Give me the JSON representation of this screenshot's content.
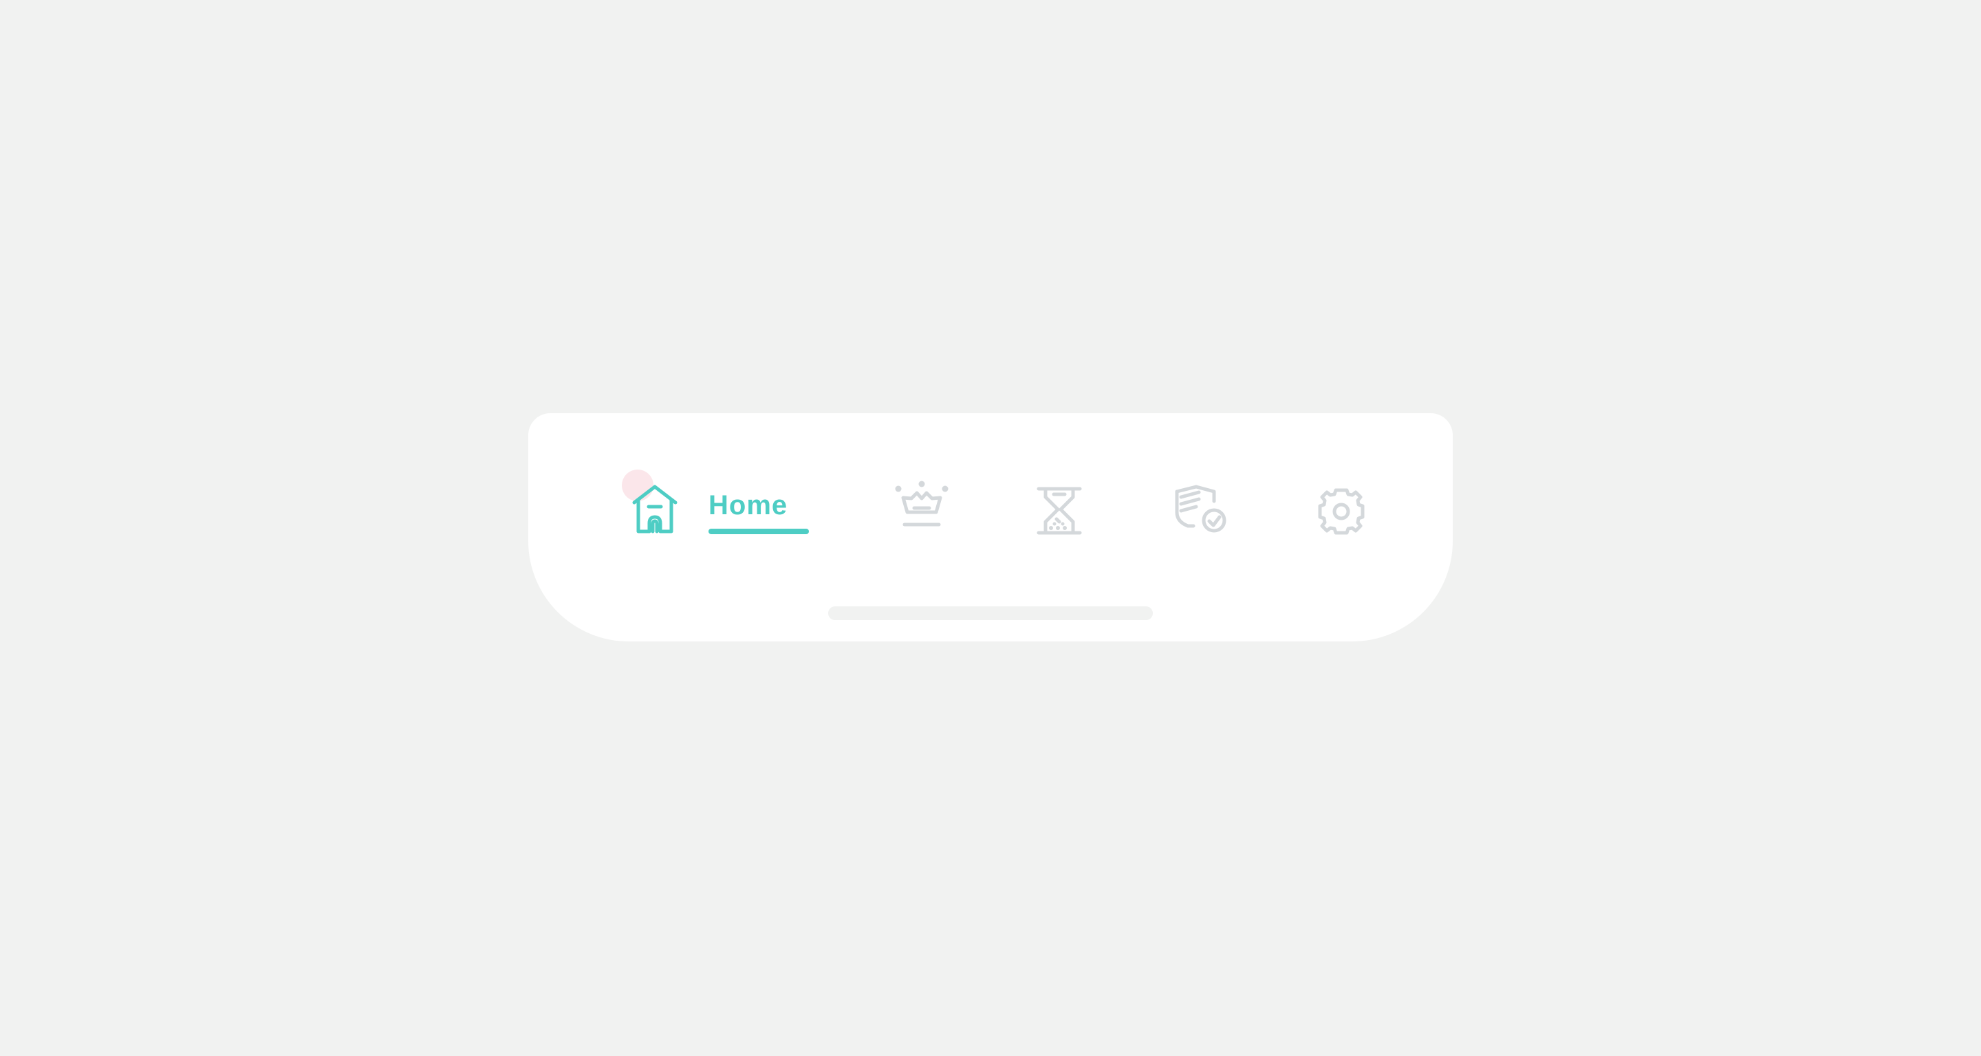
{
  "tabbar": {
    "tabs": [
      {
        "id": "home",
        "label": "Home",
        "icon": "home-icon",
        "active": true
      },
      {
        "id": "premium",
        "label": "",
        "icon": "crown-icon",
        "active": false
      },
      {
        "id": "history",
        "label": "",
        "icon": "hourglass-icon",
        "active": false
      },
      {
        "id": "insurance",
        "label": "",
        "icon": "policy-check-icon",
        "active": false
      },
      {
        "id": "settings",
        "label": "",
        "icon": "gear-icon",
        "active": false
      }
    ]
  },
  "colors": {
    "background": "#f1f2f1",
    "bar": "#ffffff",
    "active": "#4ecdc4",
    "inactive": "#d4d8db",
    "notification_dot": "#fbe6ea",
    "home_indicator": "#f1f2f1"
  }
}
